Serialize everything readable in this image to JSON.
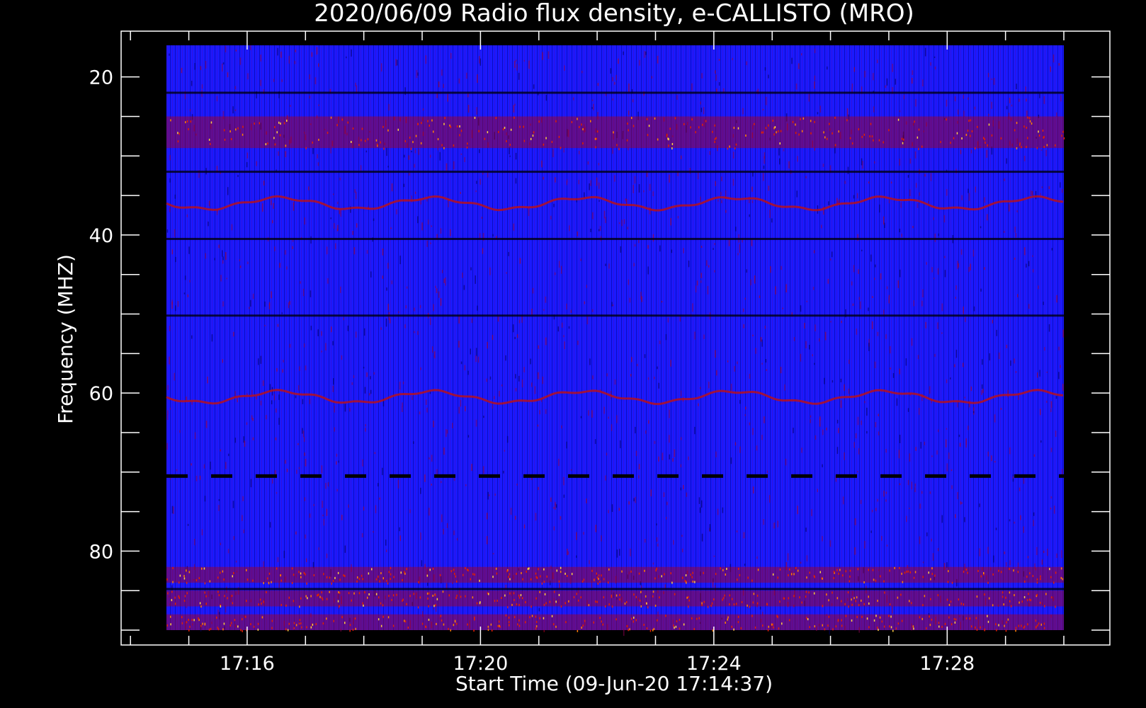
{
  "chart_data": {
    "type": "heatmap",
    "title": "2020/06/09  Radio flux density, e-CALLISTO (MRO)",
    "xlabel": "Start Time (09-Jun-20 17:14:37)",
    "ylabel": "Frequency (MHZ)",
    "x_range": [
      "17:14:37",
      "17:30:00"
    ],
    "x_ticks": [
      "17:16",
      "17:20",
      "17:24",
      "17:28"
    ],
    "ylim": [
      16,
      90
    ],
    "y_ticks": [
      20,
      40,
      60,
      80
    ],
    "y_inverted": true,
    "colormap": [
      "#000000",
      "#0000ff",
      "#c00000",
      "#ff4000",
      "#ffc000",
      "#ffffff"
    ],
    "features": [
      {
        "kind": "band",
        "freq": [
          25,
          29
        ],
        "level": "high"
      },
      {
        "kind": "band",
        "freq": [
          82,
          84
        ],
        "level": "high"
      },
      {
        "kind": "band",
        "freq": [
          85,
          87
        ],
        "level": "high"
      },
      {
        "kind": "band",
        "freq": [
          88,
          90
        ],
        "level": "high"
      },
      {
        "kind": "dark-line",
        "freq": 22
      },
      {
        "kind": "dark-line",
        "freq": 32
      },
      {
        "kind": "dark-line",
        "freq": 40.5
      },
      {
        "kind": "dark-line",
        "freq": 50.2
      },
      {
        "kind": "dashed-dark-line",
        "freq": 70.5
      },
      {
        "kind": "dark-line",
        "freq": 84.8
      },
      {
        "kind": "wavy-line",
        "freq": 60.5
      },
      {
        "kind": "wavy-line",
        "freq": 36
      }
    ],
    "colors": {
      "background": "#000000",
      "axis": "#ffffff",
      "text": "#ffffff"
    }
  }
}
